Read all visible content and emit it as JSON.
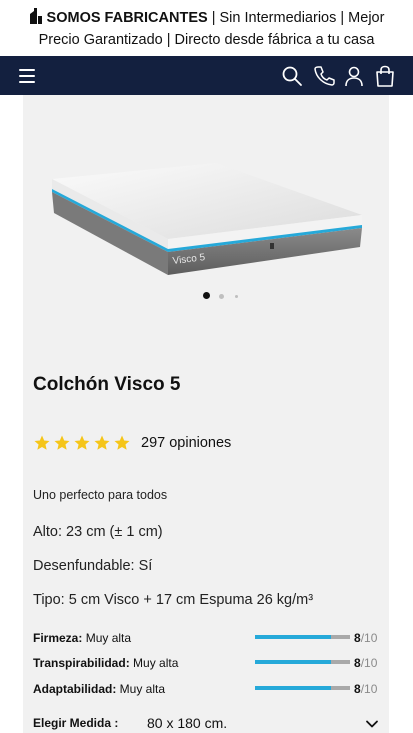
{
  "promo": {
    "bold_text": "SOMOS FABRICANTES",
    "text_line1_rest": " | Sin Intermediarios | Mejor",
    "text_line2": "Precio Garantizado | Directo desde fábrica a tu casa",
    "icon": "factory-icon"
  },
  "navbar": {
    "background": "#13203f",
    "icons": [
      "hamburger-menu-icon",
      "search-icon",
      "phone-icon",
      "user-icon",
      "shopping-bag-icon"
    ]
  },
  "product": {
    "image_label": "Visco 5",
    "carousel": {
      "slides": 3,
      "active": 1
    },
    "title": "Colchón Visco 5",
    "rating": {
      "stars": 5,
      "opinions": "297 opiniones"
    },
    "subtitle": "Uno perfecto para todos",
    "specs": {
      "alto": "Alto: 23 cm (± 1 cm)",
      "desenfundable": "Desenfundable: Sí",
      "tipo": "Tipo: 5 cm Visco + 17 cm Espuma 26 kg/m³"
    },
    "attributes": [
      {
        "label": "Firmeza:",
        "value": " Muy alta",
        "score": "8",
        "max": "/10",
        "fraction": 0.8
      },
      {
        "label": "Transpirabilidad:",
        "value": " Muy alta",
        "score": "8",
        "max": "/10",
        "fraction": 0.8
      },
      {
        "label": "Adaptabilidad:",
        "value": " Muy alta",
        "score": "8",
        "max": "/10",
        "fraction": 0.8
      }
    ],
    "size_selector": {
      "label": "Elegir Medida :",
      "value": "80 x 180 cm."
    }
  },
  "colors": {
    "accent_blue": "#26a9d9",
    "star_yellow": "#f5c518",
    "card_bg": "#f1f1f1"
  }
}
